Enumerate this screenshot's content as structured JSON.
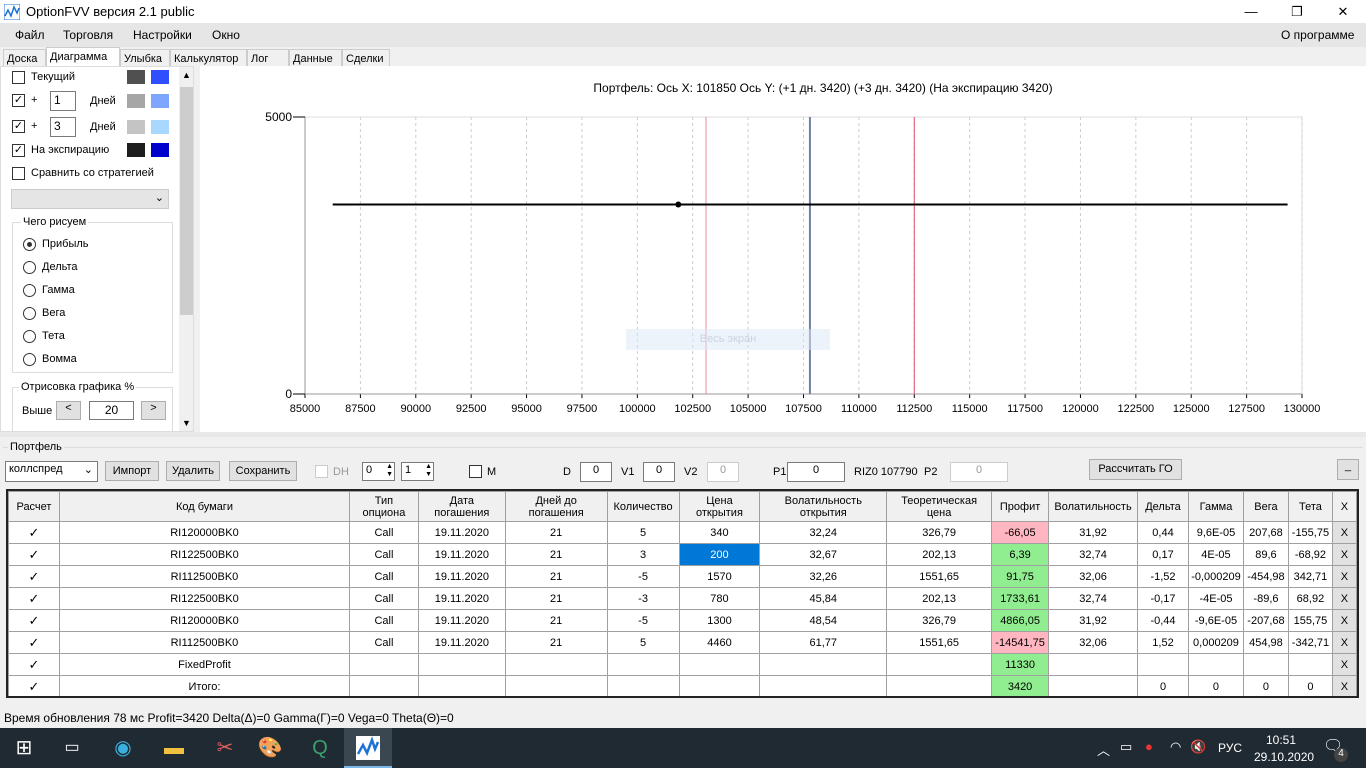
{
  "window": {
    "title": "OptionFVV версия 2.1 public",
    "minimize": "—",
    "maximize": "❐",
    "close": "✕"
  },
  "menu": {
    "items": [
      "Файл",
      "Торговля",
      "Настройки",
      "Окно"
    ],
    "about": "О программе"
  },
  "tabs": [
    "Доска",
    "Диаграмма",
    "Улыбка",
    "Калькулятор",
    "Лог",
    "Данные",
    "Сделки"
  ],
  "active_tab": "Диаграмма",
  "left": {
    "current": {
      "label": "Текущий",
      "checked": false,
      "colors": [
        "#505050",
        "#2f4fff"
      ]
    },
    "plus1": {
      "plus": "+",
      "value": "1",
      "unit": "Дней",
      "checked": true,
      "colors": [
        "#a6a6a6",
        "#7ea6ff"
      ]
    },
    "plus3": {
      "plus": "+",
      "value": "3",
      "unit": "Дней",
      "checked": true,
      "colors": [
        "#c4c4c4",
        "#a8d8ff"
      ]
    },
    "expiration": {
      "label": "На экспирацию",
      "checked": true,
      "colors": [
        "#1e1e1e",
        "#0000cc"
      ]
    },
    "compare": {
      "label": "Сравнить со стратегией",
      "checked": false
    },
    "draw_group": {
      "title": "Чего рисуем",
      "options": [
        "Прибыль",
        "Дельта",
        "Гамма",
        "Вега",
        "Тета",
        "Вомма"
      ],
      "selected": "Прибыль"
    },
    "render_group": {
      "title": "Отрисовка графика %",
      "above_label": "Выше",
      "above_value": "20",
      "prev": "<",
      "next": ">"
    }
  },
  "chart": {
    "header": "Портфель: Ось X:  101850 Ось Y:  (+1 дн. 3420)  (+3 дн. 3420)  (На экспирацию 3420)",
    "fullscreen_label": "Весь экран",
    "chart_data": {
      "type": "line",
      "xlim": [
        85000,
        130000
      ],
      "ylim": [
        0,
        5000
      ],
      "x_ticks": [
        "85000",
        "87500",
        "90000",
        "92500",
        "95000",
        "97500",
        "100000",
        "102500",
        "105000",
        "107500",
        "110000",
        "112500",
        "115000",
        "117500",
        "120000",
        "122500",
        "125000",
        "127500",
        "130000"
      ],
      "y_ticks": [
        "5000",
        "0"
      ],
      "grid": true,
      "series": [
        {
          "x": [
            86250,
            129350
          ],
          "y": [
            3420,
            3420
          ],
          "color": "#000000"
        }
      ],
      "marker": {
        "x": 101850,
        "y": 3420
      },
      "vlines": [
        {
          "x": 103100,
          "color": "#e88a9a"
        },
        {
          "x": 107790,
          "color": "#7080a0"
        },
        {
          "x": 112500,
          "color": "#e05070"
        }
      ]
    }
  },
  "portfolio": {
    "title": "Портфель",
    "strategy": "коллспред",
    "import": "Импорт",
    "delete": "Удалить",
    "save": "Сохранить",
    "dh": "DH",
    "spin1": "0",
    "spin2": "1",
    "m": "M",
    "d_label": "D",
    "d": "0",
    "v1_label": "V1",
    "v1": "0",
    "v2_label": "V2",
    "v2": "0",
    "p1_label": "P1",
    "p1": "0",
    "riz": "RIZ0 107790",
    "p2_label": "P2",
    "p2": "0",
    "calc_go": "Рассчитать ГО",
    "minimize": "_",
    "columns": [
      "Расчет",
      "Код бумаги",
      "Тип опциона",
      "Дата погашения",
      "Дней до погашения",
      "Количество",
      "Цена открытия",
      "Волатильность открытия",
      "Теоретическая цена",
      "Профит",
      "Волатильность",
      "Дельта",
      "Гамма",
      "Вега",
      "Тета",
      "X"
    ],
    "rows": [
      [
        "✓",
        "RI120000BK0",
        "Call",
        "19.11.2020",
        "21",
        "5",
        "340",
        "32,24",
        "326,79",
        "-66,05",
        "31,92",
        "0,44",
        "9,6E-05",
        "207,68",
        "-155,75",
        "X"
      ],
      [
        "✓",
        "RI122500BK0",
        "Call",
        "19.11.2020",
        "21",
        "3",
        "200",
        "32,67",
        "202,13",
        "6,39",
        "32,74",
        "0,17",
        "4E-05",
        "89,6",
        "-68,92",
        "X"
      ],
      [
        "✓",
        "RI112500BK0",
        "Call",
        "19.11.2020",
        "21",
        "-5",
        "1570",
        "32,26",
        "1551,65",
        "91,75",
        "32,06",
        "-1,52",
        "-0,000209",
        "-454,98",
        "342,71",
        "X"
      ],
      [
        "✓",
        "RI122500BK0",
        "Call",
        "19.11.2020",
        "21",
        "-3",
        "780",
        "45,84",
        "202,13",
        "1733,61",
        "32,74",
        "-0,17",
        "-4E-05",
        "-89,6",
        "68,92",
        "X"
      ],
      [
        "✓",
        "RI120000BK0",
        "Call",
        "19.11.2020",
        "21",
        "-5",
        "1300",
        "48,54",
        "326,79",
        "4866,05",
        "31,92",
        "-0,44",
        "-9,6E-05",
        "-207,68",
        "155,75",
        "X"
      ],
      [
        "✓",
        "RI112500BK0",
        "Call",
        "19.11.2020",
        "21",
        "5",
        "4460",
        "61,77",
        "1551,65",
        "-14541,75",
        "32,06",
        "1,52",
        "0,000209",
        "454,98",
        "-342,71",
        "X"
      ],
      [
        "✓",
        "FixedProfit",
        "",
        "",
        "",
        "",
        "",
        "",
        "",
        "11330",
        "",
        "",
        "",
        "",
        "",
        "X"
      ],
      [
        "✓",
        "Итого:",
        "",
        "",
        "",
        "",
        "",
        "",
        "",
        "3420",
        "",
        "0",
        "0",
        "0",
        "0",
        "X"
      ]
    ],
    "profit_colors": {
      "positive": "#90ee90",
      "negative": "#ffb6c1"
    }
  },
  "status": "Время обновления 78 мс  Profit=3420 Delta(Δ)=0 Gamma(Γ)=0 Vega=0 Theta(Θ)=0",
  "taskbar": {
    "lang": "РУС",
    "time": "10:51",
    "date": "29.10.2020",
    "notifications": "4"
  }
}
